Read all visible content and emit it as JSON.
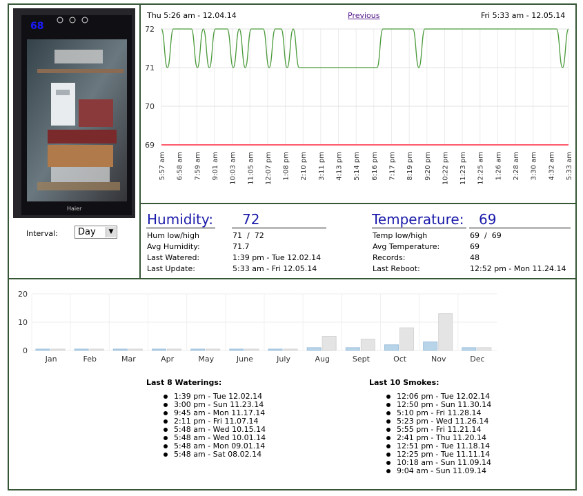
{
  "photo": {
    "display_value": "68",
    "brand": "Haier"
  },
  "interval": {
    "label": "Interval:",
    "selected": "Day"
  },
  "top_chart": {
    "start_label": "Thu 5:26 am - 12.04.14",
    "prev_label": "Previous",
    "end_label": "Fri 5:33 am - 12.05.14"
  },
  "stats": {
    "humidity": {
      "title": "Humidity:",
      "value": "72",
      "rows": [
        {
          "label": "Hum low/high",
          "value": "71  /  72"
        },
        {
          "label": "Avg Humidity:",
          "value": "71.7"
        },
        {
          "label": "Last Watered:",
          "value": "1:39 pm - Tue 12.02.14"
        },
        {
          "label": "Last Update:",
          "value": "5:33 am - Fri 12.05.14"
        }
      ]
    },
    "temperature": {
      "title": "Temperature:",
      "value": "69",
      "rows": [
        {
          "label": "Temp low/high",
          "value": "69  /  69"
        },
        {
          "label": "Avg Temperature:",
          "value": "69"
        },
        {
          "label": "Records:",
          "value": "48"
        },
        {
          "label": "Last Reboot:",
          "value": "12:52 pm - Mon 11.24.14"
        }
      ]
    }
  },
  "waterings": {
    "title": "Last 8 Waterings:",
    "items": [
      "1:39 pm - Tue 12.02.14",
      "3:00 pm - Sun 11.23.14",
      "9:45 am - Mon 11.17.14",
      "2:11 pm - Fri 11.07.14",
      "5:48 am - Wed 10.15.14",
      "5:48 am - Wed 10.01.14",
      "5:48 am - Mon 09.01.14",
      "5:48 am - Sat 08.02.14"
    ]
  },
  "smokes": {
    "title": "Last 10 Smokes:",
    "items": [
      "12:06 pm - Tue 12.02.14",
      "12:50 pm - Sun 11.30.14",
      "5:10 pm - Fri 11.28.14",
      "5:23 pm - Wed 11.26.14",
      "5:55 pm - Fri 11.21.14",
      "2:41 pm - Thu 11.20.14",
      "12:51 pm - Tue 11.18.14",
      "12:25 pm - Tue 11.11.14",
      "10:18 am - Sun 11.09.14",
      "9:04 am - Sun 11.09.14"
    ]
  },
  "chart_data": [
    {
      "type": "line",
      "y_ticks": [
        "72",
        "71",
        "70",
        "69"
      ],
      "ylim": [
        69,
        72
      ],
      "x_tick_labels": [
        "5:57 am",
        "6:58 am",
        "7:59 am",
        "9:01 am",
        "10:03 am",
        "11:05 am",
        "12:07 pm",
        "1:08 pm",
        "2:10 pm",
        "3:11 pm",
        "4:13 pm",
        "5:14 pm",
        "6:16 pm",
        "7:17 pm",
        "8:19 pm",
        "9:20 pm",
        "10:22 pm",
        "11:23 pm",
        "12:25 am",
        "1:26 am",
        "2:28 am",
        "3:30 am",
        "4:32 am",
        "5:33 am"
      ],
      "series": [
        {
          "color": "#4a9a3a",
          "values": [
            72,
            71,
            72,
            72,
            72,
            72,
            71,
            72,
            71,
            72,
            72,
            72,
            71,
            72,
            71,
            72,
            72,
            72,
            71,
            72,
            72,
            71,
            72,
            71,
            71,
            71,
            71,
            71,
            71,
            71,
            71,
            71,
            71,
            71,
            71,
            71,
            71,
            72,
            72,
            72,
            72,
            72,
            72,
            71,
            72,
            72,
            72,
            72,
            72,
            72,
            72,
            72,
            72,
            72,
            72,
            72,
            72,
            72,
            72,
            72,
            72,
            72,
            72,
            72,
            72,
            72,
            72,
            71,
            72
          ]
        },
        {
          "color": "#ff5a6a",
          "values": [
            69,
            69,
            69,
            69,
            69,
            69,
            69,
            69,
            69,
            69,
            69,
            69,
            69,
            69,
            69,
            69,
            69,
            69,
            69,
            69,
            69,
            69,
            69,
            69,
            69,
            69,
            69,
            69,
            69,
            69,
            69,
            69,
            69,
            69,
            69,
            69,
            69,
            69,
            69,
            69,
            69,
            69,
            69,
            69,
            69,
            69,
            69,
            69,
            69,
            69,
            69,
            69,
            69,
            69,
            69,
            69,
            69,
            69,
            69,
            69,
            69,
            69,
            69,
            69,
            69,
            69,
            69,
            69,
            69
          ]
        }
      ]
    },
    {
      "type": "bar",
      "categories": [
        "Jan",
        "Feb",
        "Mar",
        "Apr",
        "May",
        "June",
        "July",
        "Aug",
        "Sept",
        "Oct",
        "Nov",
        "Dec"
      ],
      "y_ticks": [
        "20",
        "10",
        "0"
      ],
      "ylim": [
        0,
        20
      ],
      "series": [
        {
          "color": "#b8d4e8",
          "values": [
            0,
            0,
            0,
            0,
            0,
            0,
            0,
            1,
            1,
            2,
            3,
            1
          ]
        },
        {
          "color": "#e4e4e4",
          "values": [
            0,
            0,
            0,
            0,
            0,
            0,
            0,
            5,
            4,
            8,
            13,
            1
          ]
        }
      ]
    }
  ]
}
